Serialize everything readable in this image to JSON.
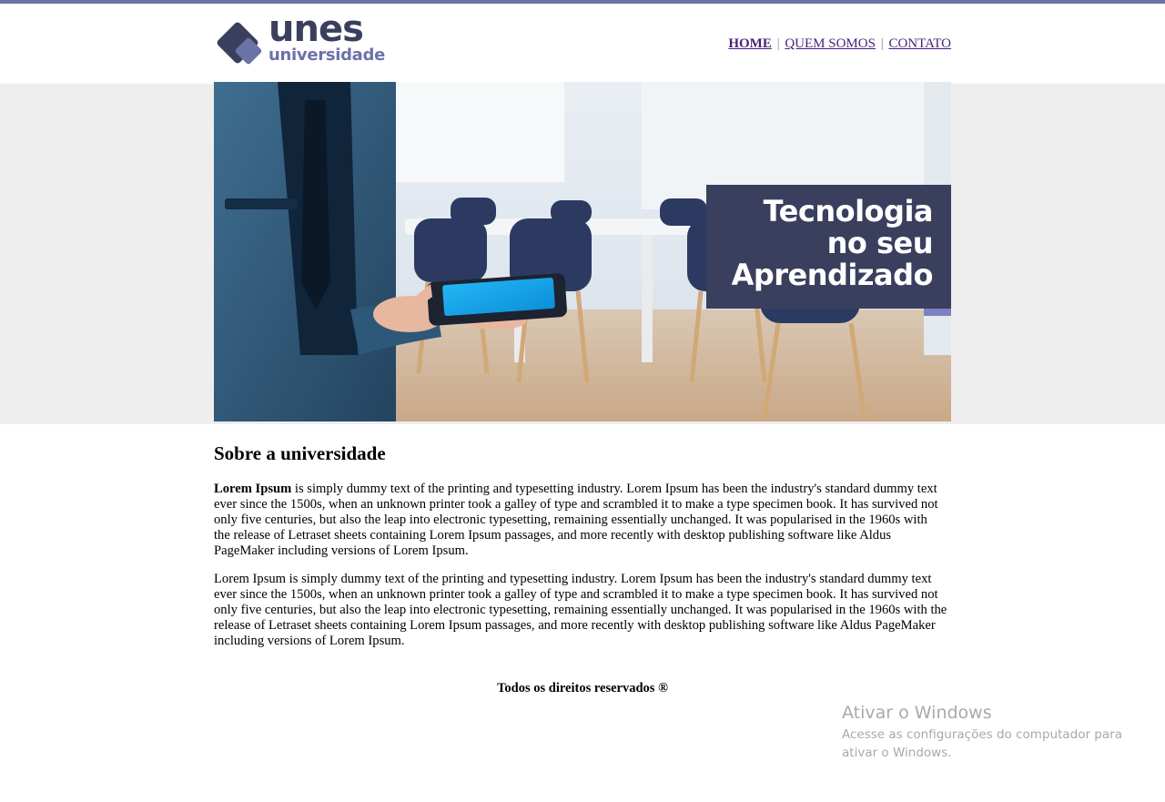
{
  "brand": {
    "name": "unes",
    "subtitle": "universidade"
  },
  "nav": {
    "home": "HOME",
    "about": "QUEM SOMOS",
    "contact": "CONTATO",
    "separator": "|"
  },
  "banner": {
    "line1": "Tecnologia",
    "line2": "no seu",
    "line3": "Aprendizado"
  },
  "content": {
    "heading": "Sobre a universidade",
    "p1_bold": "Lorem Ipsum",
    "p1_rest": " is simply dummy text of the printing and typesetting industry. Lorem Ipsum has been the industry's standard dummy text ever since the 1500s, when an unknown printer took a galley of type and scrambled it to make a type specimen book. It has survived not only five centuries, but also the leap into electronic typesetting, remaining essentially unchanged. It was popularised in the 1960s with the release of Letraset sheets containing Lorem Ipsum passages, and more recently with desktop publishing software like Aldus PageMaker including versions of Lorem Ipsum.",
    "p2": "Lorem Ipsum is simply dummy text of the printing and typesetting industry. Lorem Ipsum has been the industry's standard dummy text ever since the 1500s, when an unknown printer took a galley of type and scrambled it to make a type specimen book. It has survived not only five centuries, but also the leap into electronic typesetting, remaining essentially unchanged. It was popularised in the 1960s with the release of Letraset sheets containing Lorem Ipsum passages, and more recently with desktop publishing software like Aldus PageMaker including versions of Lorem Ipsum."
  },
  "footer": {
    "text": "Todos os direitos reservados ®"
  },
  "watermark": {
    "title": "Ativar o Windows",
    "subtitle": "Acesse as configurações do computador para ativar o Windows."
  },
  "colors": {
    "top_bar": "#6b72a8",
    "brand_dark": "#3b3f5e",
    "brand_light": "#6b72a8",
    "link": "#4a1f7a",
    "band": "#eeeeee"
  }
}
